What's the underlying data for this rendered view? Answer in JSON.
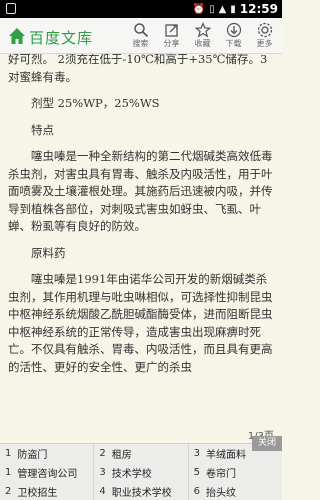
{
  "status_bar": {
    "time": "12:59"
  },
  "app": {
    "title": "百度文库"
  },
  "toolbar": [
    {
      "icon": "search-icon",
      "label": "搜索"
    },
    {
      "icon": "share-icon",
      "label": "分享"
    },
    {
      "icon": "star-icon",
      "label": "收藏"
    },
    {
      "icon": "download-icon",
      "label": "下载"
    },
    {
      "icon": "more-icon",
      "label": "更多"
    }
  ],
  "document": {
    "intro": "好可烈。   2须充在低于-10℃和高于+35℃储存。3对蜜蜂有毒。",
    "formulation_line": "剂型 25%WP，25%WS",
    "heading_features": "特点",
    "features_text": "噻虫嗪是一种全新结构的第二代烟碱类高效低毒杀虫剂，对害虫具有胃毒、触杀及内吸活性，用于叶面喷雾及土壤灌根处理。其施药后迅速被内吸，并传导到植株各部位，对刺吸式害虫如蚜虫、飞虱、叶蝉、粉虱等有良好的防效。",
    "heading_origin": "原料药",
    "origin_text": "噻虫嗪是1991年由诺华公司开发的新烟碱类杀虫剂，其作用机理与吡虫啉相似，可选择性抑制昆虫中枢神经系统烟酸乙酰胆碱酯酶受体，进而阻断昆虫中枢神经系统的正常传导，造成害虫出现麻痹时死亡。不仅具有触杀、胃毒、内吸活性，而且具有更高的活性、更好的安全性、更广的杀虫"
  },
  "page_indicator": "1/3页",
  "ads": {
    "close_label": "关闭",
    "rows": [
      [
        {
          "n": "1",
          "t": "防盗门"
        },
        {
          "n": "2",
          "t": "租房"
        },
        {
          "n": "3",
          "t": "羊绒面料"
        }
      ],
      [
        {
          "n": "1",
          "t": "管理咨询公司"
        },
        {
          "n": "3",
          "t": "技术学校"
        },
        {
          "n": "5",
          "t": "卷帘门"
        }
      ],
      [
        {
          "n": "2",
          "t": "卫校招生"
        },
        {
          "n": "4",
          "t": "职业技术学校"
        },
        {
          "n": "6",
          "t": "抬头纹"
        }
      ]
    ]
  }
}
